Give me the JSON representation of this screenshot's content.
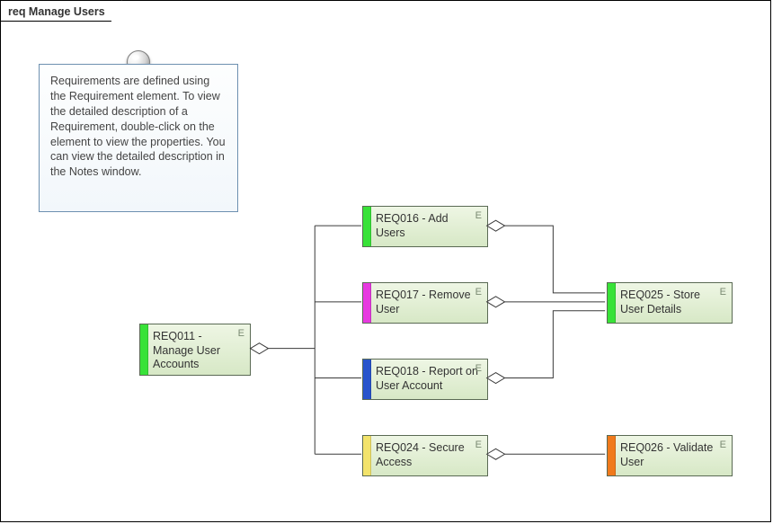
{
  "diagram": {
    "title": "req Manage Users"
  },
  "note": {
    "text": "Requirements are defined using the Requirement element.  To view the detailed description of a Requirement, double-click on the element to view the properties. You can view the detailed description in the Notes window."
  },
  "requirements": {
    "req011": {
      "id": "REQ011",
      "label": "REQ011 - Manage User Accounts",
      "accent": "#38e238",
      "e_mark": "E"
    },
    "req016": {
      "id": "REQ016",
      "label": "REQ016 - Add Users",
      "accent": "#38e238",
      "e_mark": "E"
    },
    "req017": {
      "id": "REQ017",
      "label": "REQ017 - Remove User",
      "accent": "#e73ae0",
      "e_mark": "E"
    },
    "req018": {
      "id": "REQ018",
      "label": "REQ018 - Report on User Account",
      "accent": "#2854cc",
      "e_mark": "E"
    },
    "req024": {
      "id": "REQ024",
      "label": "REQ024 - Secure Access",
      "accent": "#f2e36b",
      "e_mark": "E"
    },
    "req025": {
      "id": "REQ025",
      "label": "REQ025 - Store User Details",
      "accent": "#38e238",
      "e_mark": "E"
    },
    "req026": {
      "id": "REQ026",
      "label": "REQ026 - Validate User",
      "accent": "#f07a1c",
      "e_mark": "E"
    }
  }
}
